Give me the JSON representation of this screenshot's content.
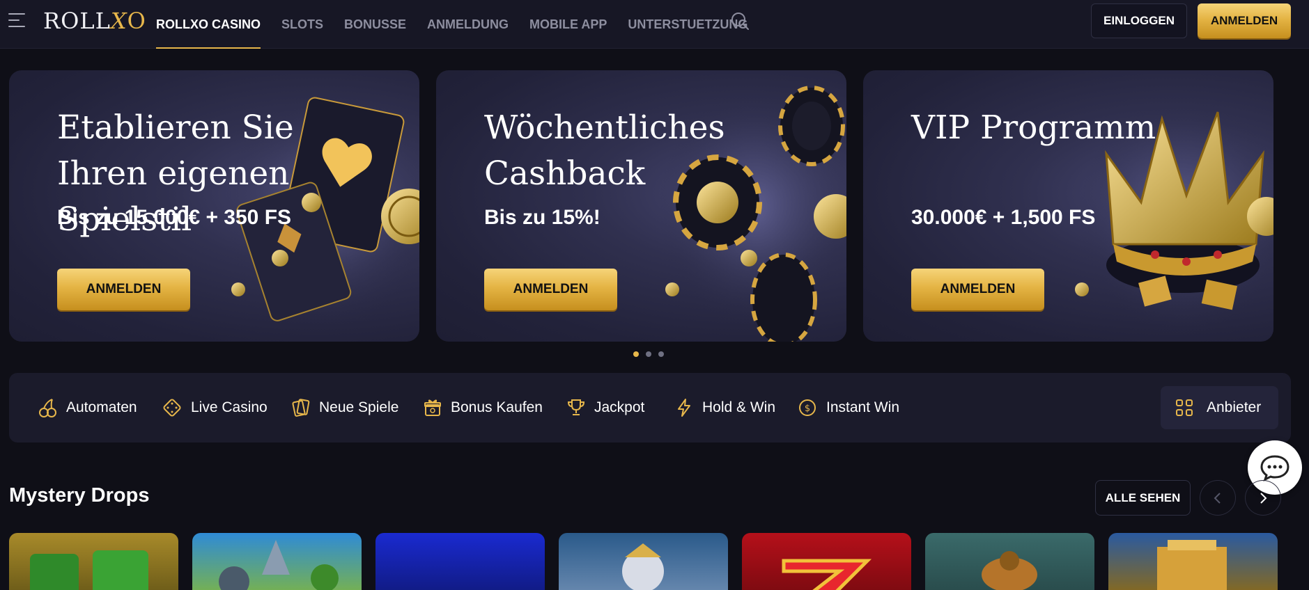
{
  "header": {
    "logo_text": "ROLLXO",
    "nav": [
      "ROLLXO CASINO",
      "SLOTS",
      "BONUSSE",
      "ANMELDUNG",
      "MOBILE APP",
      "UNTERSTUETZUNG"
    ],
    "login_label": "EINLOGGEN",
    "register_label": "ANMELDEN"
  },
  "banners": [
    {
      "title": "Etablieren Sie Ihren eigenen Spielstil",
      "subtitle": "Bis zu 15.000€ + 350 FS",
      "button": "ANMELDEN",
      "art": "cards"
    },
    {
      "title": "Wöchentliches Cashback",
      "subtitle": "Bis zu 15%!",
      "button": "ANMELDEN",
      "art": "chips"
    },
    {
      "title": "VIP Programm",
      "subtitle": "30.000€ + 1,500 FS",
      "button": "ANMELDEN",
      "art": "crown"
    }
  ],
  "carousel": {
    "pages": 3,
    "active": 1
  },
  "categories": [
    {
      "label": "Automaten",
      "icon": "cherry-icon"
    },
    {
      "label": "Live Casino",
      "icon": "dice-icon"
    },
    {
      "label": "Neue Spiele",
      "icon": "cards-icon"
    },
    {
      "label": "Bonus Kaufen",
      "icon": "gift-icon"
    },
    {
      "label": "Jackpot",
      "icon": "trophy-icon"
    },
    {
      "label": "Hold & Win",
      "icon": "lightning-icon"
    },
    {
      "label": "Instant Win",
      "icon": "coin-icon"
    }
  ],
  "providers_label": "Anbieter",
  "section": {
    "title": "Mystery Drops",
    "see_all": "ALLE SEHEN"
  },
  "colors": {
    "accent": "#e7b74b",
    "background": "#0f0f17",
    "header": "#171725",
    "panel": "#1b1b2b"
  },
  "game_tiles": [
    {
      "theme": "green-gold"
    },
    {
      "theme": "blue-sky"
    },
    {
      "theme": "deep-blue"
    },
    {
      "theme": "zeus"
    },
    {
      "theme": "red-seven"
    },
    {
      "theme": "frog"
    },
    {
      "theme": "temple"
    }
  ]
}
